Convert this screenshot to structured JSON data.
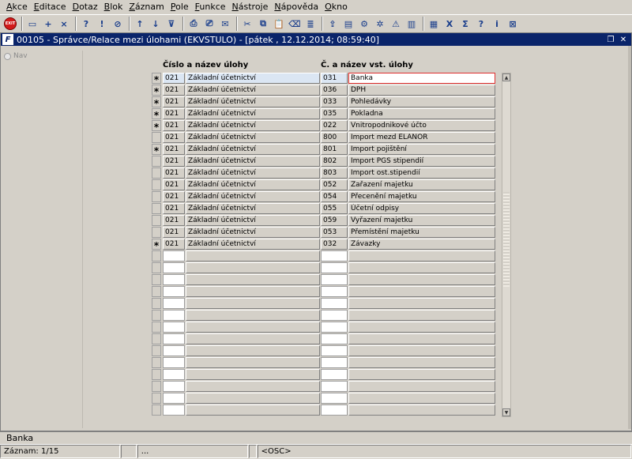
{
  "menu": [
    "Akce",
    "Editace",
    "Dotaz",
    "Blok",
    "Záznam",
    "Pole",
    "Funkce",
    "Nástroje",
    "Nápověda",
    "Okno"
  ],
  "toolbar": {
    "exit_label": "EXIT",
    "icons": [
      "new-record-icon",
      "insert-record-icon",
      "delete-record-icon",
      "enter-query-icon",
      "execute-query-icon",
      "cancel-query-icon",
      "sort-asc-icon",
      "sort-desc-icon",
      "filter-icon",
      "print-icon",
      "print-preview-icon",
      "mail-icon",
      "cut-icon",
      "copy-icon",
      "paste-icon",
      "clear-icon",
      "list-icon",
      "export-icon",
      "document-icon",
      "settings-icon",
      "gear-icon",
      "warning-icon",
      "chart-icon",
      "calculator-icon",
      "excel-icon",
      "sum-icon",
      "help-icon",
      "info-icon",
      "close-window-icon"
    ]
  },
  "window": {
    "app_icon": "F",
    "title": "00105 - Správce/Relace mezi úlohami (EKVSTULO) - [pátek , 12.12.2014; 08:59:40]",
    "restore_glyph": "❐",
    "close_glyph": "✕"
  },
  "nav": {
    "label": "Nav"
  },
  "headers": {
    "task": "Číslo a název úlohy",
    "input_task": "Č. a název vst. úlohy"
  },
  "rows": [
    {
      "mark": "*",
      "code": "021",
      "name": "Základní účetnictví",
      "in_code": "031",
      "in_name": "Banka"
    },
    {
      "mark": "*",
      "code": "021",
      "name": "Základní účetnictví",
      "in_code": "036",
      "in_name": "DPH"
    },
    {
      "mark": "*",
      "code": "021",
      "name": "Základní účetnictví",
      "in_code": "033",
      "in_name": "Pohledávky"
    },
    {
      "mark": "*",
      "code": "021",
      "name": "Základní účetnictví",
      "in_code": "035",
      "in_name": "Pokladna"
    },
    {
      "mark": "*",
      "code": "021",
      "name": "Základní účetnictví",
      "in_code": "022",
      "in_name": "Vnitropodnikové účto"
    },
    {
      "mark": "",
      "code": "021",
      "name": "Základní účetnictví",
      "in_code": "800",
      "in_name": "Import mezd ELANOR"
    },
    {
      "mark": "*",
      "code": "021",
      "name": "Základní účetnictví",
      "in_code": "801",
      "in_name": "Import pojištění"
    },
    {
      "mark": "",
      "code": "021",
      "name": "Základní účetnictví",
      "in_code": "802",
      "in_name": "Import PGS stipendií"
    },
    {
      "mark": "",
      "code": "021",
      "name": "Základní účetnictví",
      "in_code": "803",
      "in_name": "Import ost.stipendií"
    },
    {
      "mark": "",
      "code": "021",
      "name": "Základní účetnictví",
      "in_code": "052",
      "in_name": "Zařazení majetku"
    },
    {
      "mark": "",
      "code": "021",
      "name": "Základní účetnictví",
      "in_code": "054",
      "in_name": "Přecenění majetku"
    },
    {
      "mark": "",
      "code": "021",
      "name": "Základní účetnictví",
      "in_code": "055",
      "in_name": "Účetní odpisy"
    },
    {
      "mark": "",
      "code": "021",
      "name": "Základní účetnictví",
      "in_code": "059",
      "in_name": "Vyřazení majetku"
    },
    {
      "mark": "",
      "code": "021",
      "name": "Základní účetnictví",
      "in_code": "053",
      "in_name": "Přemístění majetku"
    },
    {
      "mark": "*",
      "code": "021",
      "name": "Základní účetnictví",
      "in_code": "032",
      "in_name": "Závazky"
    }
  ],
  "empty_rows": 14,
  "status": {
    "field_value": "Banka",
    "record": "Záznam: 1/15",
    "seg2": "...",
    "seg3": "",
    "mode": "<OSC>"
  },
  "colors": {
    "title_bar": "#0a246a",
    "focused_border": "#e03030",
    "active_cell": "#dbe6f3"
  }
}
